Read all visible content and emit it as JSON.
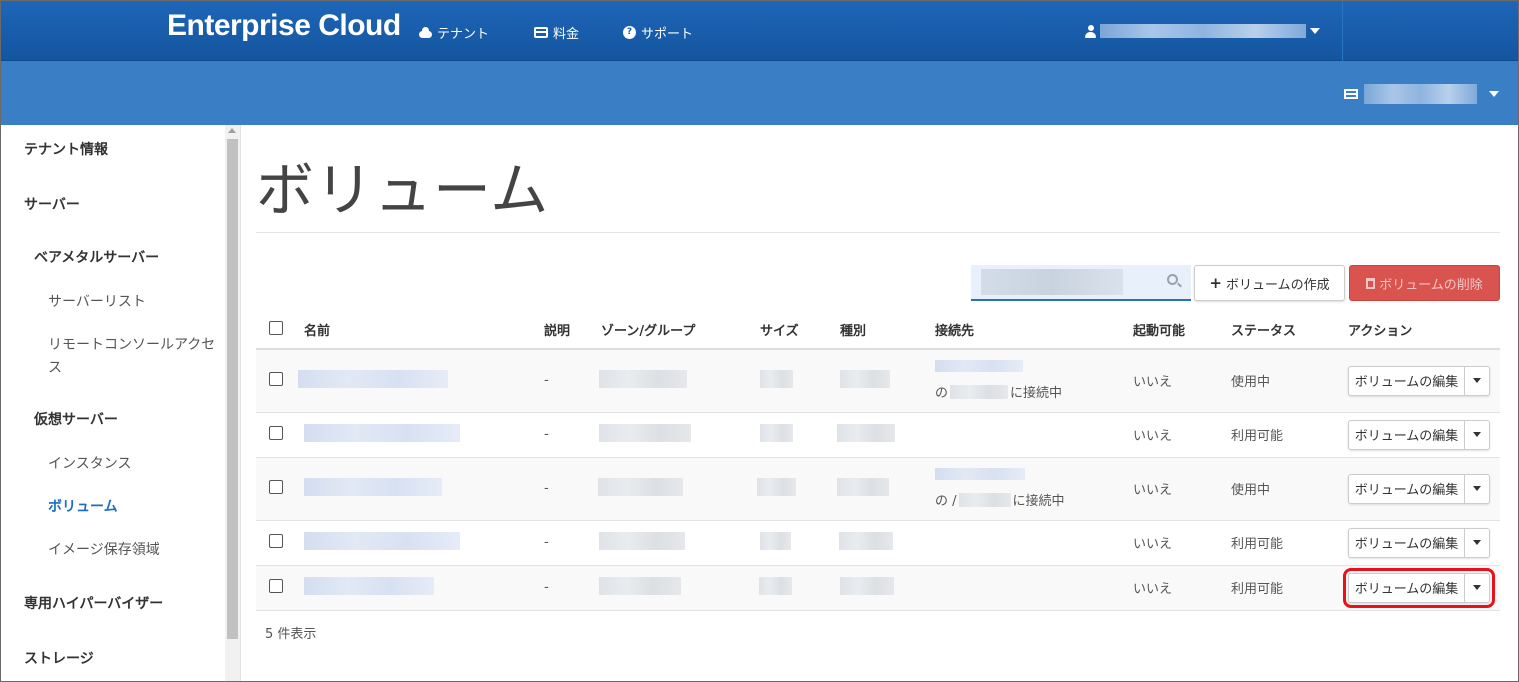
{
  "header": {
    "brand": "Enterprise Cloud",
    "nav": [
      {
        "label": "テナント",
        "icon": "cloud-icon"
      },
      {
        "label": "料金",
        "icon": "credit-card-icon"
      },
      {
        "label": "サポート",
        "icon": "question-circle-icon"
      }
    ]
  },
  "sidebar": {
    "items": [
      {
        "label": "テナント情報",
        "level": 1
      },
      {
        "label": "サーバー",
        "level": 1
      },
      {
        "label": "ベアメタルサーバー",
        "level": 2
      },
      {
        "label": "サーバーリスト",
        "level": 3
      },
      {
        "label": "リモートコンソールアクセス",
        "level": 3
      },
      {
        "label": "仮想サーバー",
        "level": 2
      },
      {
        "label": "インスタンス",
        "level": 3
      },
      {
        "label": "ボリューム",
        "level": 3,
        "active": true
      },
      {
        "label": "イメージ保存領域",
        "level": 3
      },
      {
        "label": "専用ハイパーバイザー",
        "level": 1
      },
      {
        "label": "ストレージ",
        "level": 1
      }
    ]
  },
  "main": {
    "title": "ボリューム",
    "create_button": "ボリュームの作成",
    "delete_button": "ボリュームの削除",
    "table": {
      "headers": [
        "名前",
        "説明",
        "ゾーン/グループ",
        "サイズ",
        "種別",
        "接続先",
        "起動可能",
        "ステータス",
        "アクション"
      ],
      "rows": [
        {
          "description": "-",
          "connection_prefix": "の",
          "connection_suffix": "に接続中",
          "bootable": "いいえ",
          "status": "使用中",
          "action": "ボリュームの編集"
        },
        {
          "description": "-",
          "bootable": "いいえ",
          "status": "利用可能",
          "action": "ボリュームの編集"
        },
        {
          "description": "-",
          "connection_prefix": "の /",
          "connection_suffix": "に接続中",
          "bootable": "いいえ",
          "status": "使用中",
          "action": "ボリュームの編集"
        },
        {
          "description": "-",
          "bootable": "いいえ",
          "status": "利用可能",
          "action": "ボリュームの編集"
        },
        {
          "description": "-",
          "bootable": "いいえ",
          "status": "利用可能",
          "action": "ボリュームの編集"
        }
      ]
    },
    "count_label": "5 件表示"
  },
  "colors": {
    "navbar": "#1a5fae",
    "subbar": "#3a7fc6",
    "accent": "#1a6cc4",
    "danger": "#d9534f",
    "highlight": "#e8101a"
  }
}
